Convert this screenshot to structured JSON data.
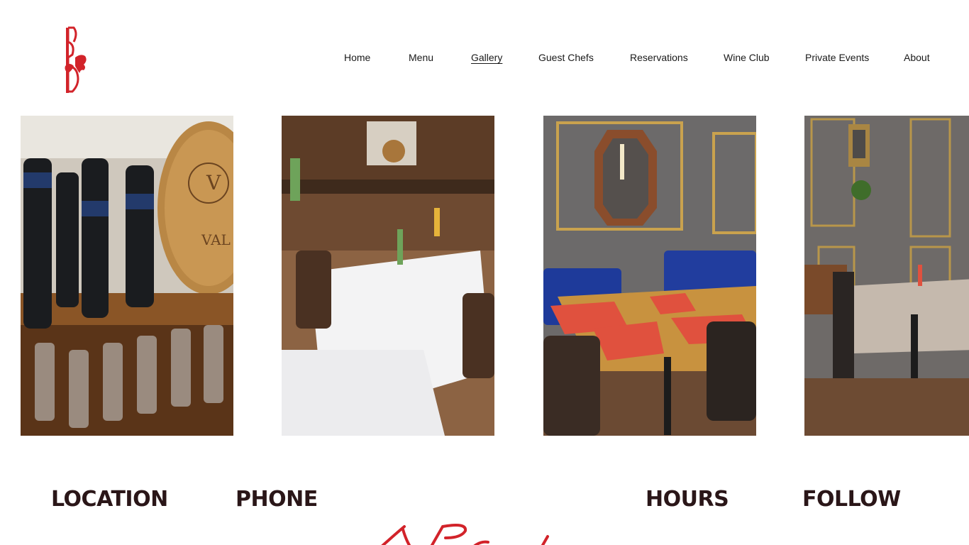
{
  "brand": {
    "logo_icon": "rooster-b-logo-icon",
    "logo_color": "#d2232a"
  },
  "nav": {
    "items": [
      {
        "label": "Home",
        "active": false
      },
      {
        "label": "Menu",
        "active": false
      },
      {
        "label": "Gallery",
        "active": true
      },
      {
        "label": "Guest Chefs",
        "active": false
      },
      {
        "label": "Reservations",
        "active": false
      },
      {
        "label": "Wine Club",
        "active": false
      },
      {
        "label": "Private Events",
        "active": false
      },
      {
        "label": "About",
        "active": false
      }
    ]
  },
  "gallery": {
    "photos": [
      {
        "subject": "wine-bottles-on-shelf"
      },
      {
        "subject": "dining-room-white-tablecloths"
      },
      {
        "subject": "blue-booth-table-red-placemats"
      },
      {
        "subject": "mirror-wall-dining-table"
      }
    ]
  },
  "footer": {
    "location_heading": "LOCATION",
    "phone_heading": "PHONE",
    "hours_heading": "HOURS",
    "follow_heading": "FOLLOW"
  },
  "colors": {
    "heading": "#2a1618",
    "accent_red": "#d2232a",
    "nav_text": "#1a1a1a"
  }
}
